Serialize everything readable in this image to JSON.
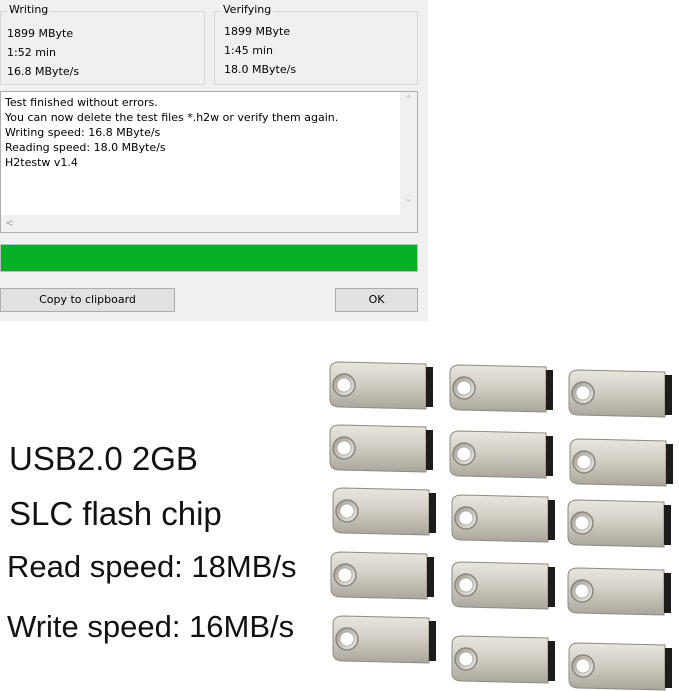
{
  "dialog": {
    "writing": {
      "title": "Writing",
      "size": "1899 MByte",
      "time": "1:52 min",
      "speed": "16.8 MByte/s"
    },
    "verifying": {
      "title": "Verifying",
      "size": "1899 MByte",
      "time": "1:45 min",
      "speed": "18.0 MByte/s"
    },
    "log_lines": [
      "Test finished without errors.",
      "You can now delete the test files *.h2w or verify them again.",
      "Writing speed: 16.8 MByte/s",
      "Reading speed: 18.0 MByte/s",
      "H2testw v1.4"
    ],
    "progress_percent": 100,
    "progress_color": "#06b025",
    "copy_button": "Copy to clipboard",
    "ok_button": "OK"
  },
  "promo": {
    "lines": [
      "USB2.0  2GB",
      "SLC flash chip",
      "Read speed: 18MB/s",
      "Write speed: 16MB/s"
    ],
    "product_icon": "usb-flash-drive-icon",
    "drive_count": 15
  }
}
